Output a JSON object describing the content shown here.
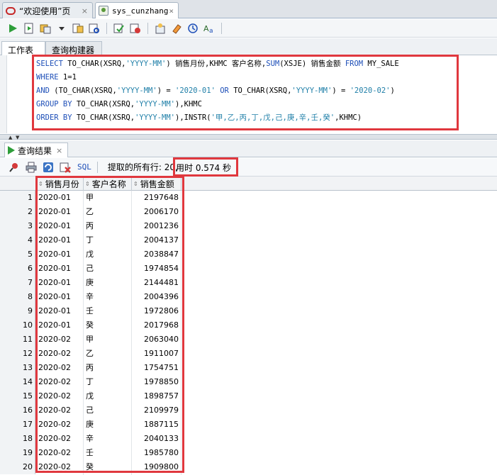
{
  "tabs": [
    {
      "label": "“欢迎使用”页",
      "close": "×"
    },
    {
      "label": "sys_cunzhang",
      "close": "×"
    }
  ],
  "worksheet_tabs": [
    "工作表",
    "查询构建器"
  ],
  "sql_lines": [
    "SELECT TO_CHAR(XSRQ,'YYYY-MM') 销售月份,KHMC 客户名称,SUM(XSJE) 销售金额 FROM MY_SALE",
    "WHERE 1=1",
    "AND (TO_CHAR(XSRQ,'YYYY-MM') = '2020-01' OR TO_CHAR(XSRQ,'YYYY-MM') = '2020-02')",
    "GROUP BY TO_CHAR(XSRQ,'YYYY-MM'),KHMC",
    "ORDER BY TO_CHAR(XSRQ,'YYYY-MM'),INSTR('甲,乙,丙,丁,戊,己,庚,辛,壬,癸',KHMC)"
  ],
  "result_tab": {
    "label": "查询结果",
    "close": "×"
  },
  "result_toolbar": {
    "sql_label": "SQL",
    "rows_text": "提取的所有行: 20,",
    "time_text": "用时 0.574 秒"
  },
  "columns": [
    "销售月份",
    "客户名称",
    "销售金额"
  ],
  "rows": [
    [
      "1",
      "2020-01",
      "甲",
      "2197648"
    ],
    [
      "2",
      "2020-01",
      "乙",
      "2006170"
    ],
    [
      "3",
      "2020-01",
      "丙",
      "2001236"
    ],
    [
      "4",
      "2020-01",
      "丁",
      "2004137"
    ],
    [
      "5",
      "2020-01",
      "戊",
      "2038847"
    ],
    [
      "6",
      "2020-01",
      "己",
      "1974854"
    ],
    [
      "7",
      "2020-01",
      "庚",
      "2144481"
    ],
    [
      "8",
      "2020-01",
      "辛",
      "2004396"
    ],
    [
      "9",
      "2020-01",
      "壬",
      "1972806"
    ],
    [
      "10",
      "2020-01",
      "癸",
      "2017968"
    ],
    [
      "11",
      "2020-02",
      "甲",
      "2063040"
    ],
    [
      "12",
      "2020-02",
      "乙",
      "1911007"
    ],
    [
      "13",
      "2020-02",
      "丙",
      "1754751"
    ],
    [
      "14",
      "2020-02",
      "丁",
      "1978850"
    ],
    [
      "15",
      "2020-02",
      "戊",
      "1898757"
    ],
    [
      "16",
      "2020-02",
      "己",
      "2109979"
    ],
    [
      "17",
      "2020-02",
      "庚",
      "1887115"
    ],
    [
      "18",
      "2020-02",
      "辛",
      "2040133"
    ],
    [
      "19",
      "2020-02",
      "壬",
      "1985780"
    ],
    [
      "20",
      "2020-02",
      "癸",
      "1909800"
    ]
  ],
  "colors": {
    "highlight_box": "#e0383e",
    "keyword": "#1e4fb8",
    "string": "#1f7fa8"
  }
}
